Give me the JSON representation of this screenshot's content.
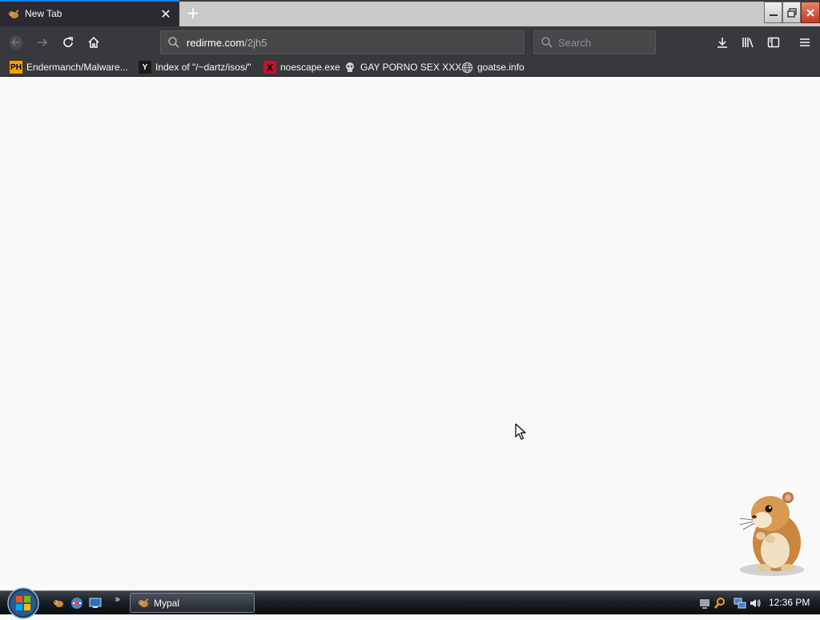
{
  "browser": {
    "tab": {
      "title": "New Tab",
      "icon": "hamster-icon",
      "close_glyph": "✕"
    },
    "newtab_glyph": "+",
    "url": {
      "host": "redirme.com",
      "path": "/2jh5"
    },
    "search": {
      "placeholder": "Search"
    }
  },
  "bookmarks": [
    {
      "label": "Endermanch/Malware...",
      "icon": "ph-icon",
      "icon_text": "PH"
    },
    {
      "label": "Index of \"/~dartz/isos/\"",
      "icon": "yc-icon",
      "icon_text": "Y"
    },
    {
      "label": "noescape.exe",
      "icon": "x-icon",
      "icon_text": "X"
    },
    {
      "label": "GAY PORNO SEX XXX",
      "icon": "skull-icon",
      "icon_text": ""
    },
    {
      "label": "goatse.info",
      "icon": "globe-icon",
      "icon_text": ""
    }
  ],
  "taskbar": {
    "task_label": "Mypal",
    "more_glyph": "»",
    "clock": "12:36 PM"
  },
  "colors": {
    "accent": "#0a84ff",
    "toolbar": "#38383d",
    "content": "#f9f9fa"
  }
}
